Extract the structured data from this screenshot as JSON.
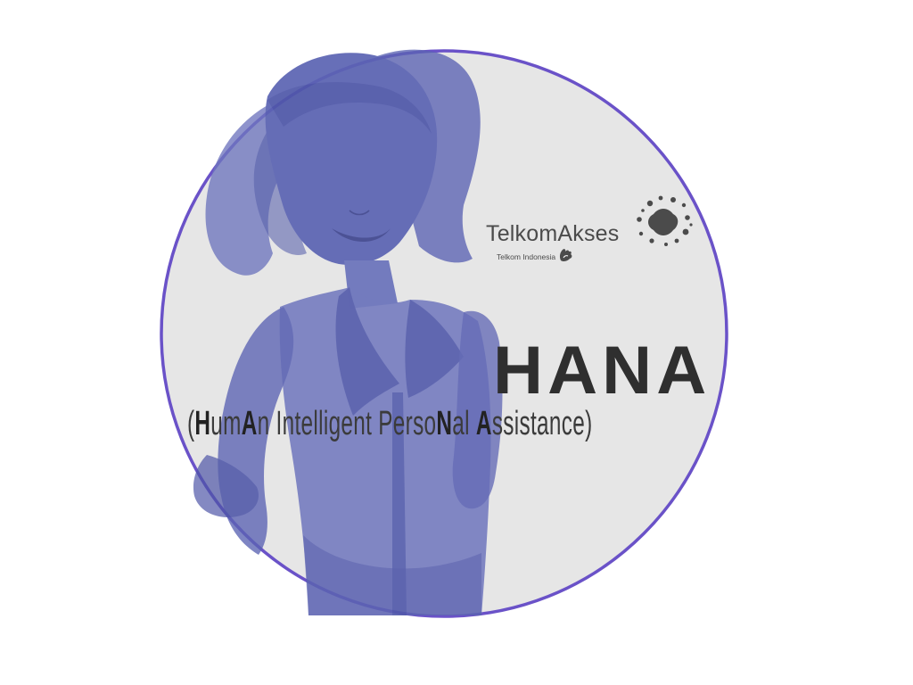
{
  "brand": {
    "name": "TelkomAkses",
    "parent": "Telkom Indonesia",
    "star_icon": "telkomakses-splash-icon",
    "hand_icon": "telkom-hand-icon",
    "text_color": "#4b4b4b",
    "star_color": "#4b4b4b"
  },
  "product": {
    "title": "HANA",
    "subtitle": {
      "open": "(",
      "parts": [
        {
          "text": "H",
          "bold": true
        },
        {
          "text": "um",
          "bold": false
        },
        {
          "text": "A",
          "bold": true
        },
        {
          "text": "n Intelligent Perso",
          "bold": false
        },
        {
          "text": "N",
          "bold": true
        },
        {
          "text": "al ",
          "bold": false
        },
        {
          "text": "A",
          "bold": true
        },
        {
          "text": "ssistance",
          "bold": false
        }
      ],
      "close": ")"
    }
  },
  "colors": {
    "circle_fill": "#e6e6e6",
    "circle_border": "#6a52c8",
    "figure_main": "#5b63b3",
    "figure_dark": "#4c54a6",
    "figure_light": "#7e85c6",
    "title_color": "#2f2f2f"
  }
}
